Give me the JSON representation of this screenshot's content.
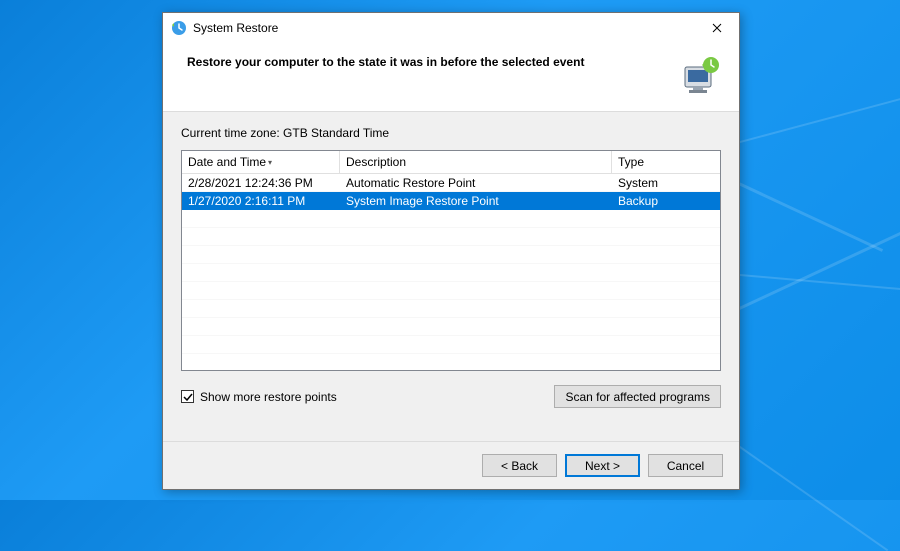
{
  "titlebar": {
    "title": "System Restore"
  },
  "header": {
    "text": "Restore your computer to the state it was in before the selected event"
  },
  "timezone_label": "Current time zone: GTB Standard Time",
  "columns": {
    "date_time": "Date and Time",
    "description": "Description",
    "type": "Type"
  },
  "rows": [
    {
      "date": "2/28/2021 12:24:36 PM",
      "desc": "Automatic Restore Point",
      "type": "System",
      "selected": false
    },
    {
      "date": "1/27/2020 2:16:11 PM",
      "desc": "System Image Restore Point",
      "type": "Backup",
      "selected": true
    }
  ],
  "checkbox": {
    "label": "Show more restore points",
    "checked": true
  },
  "buttons": {
    "scan": "Scan for affected programs",
    "back": "< Back",
    "next": "Next >",
    "cancel": "Cancel"
  }
}
